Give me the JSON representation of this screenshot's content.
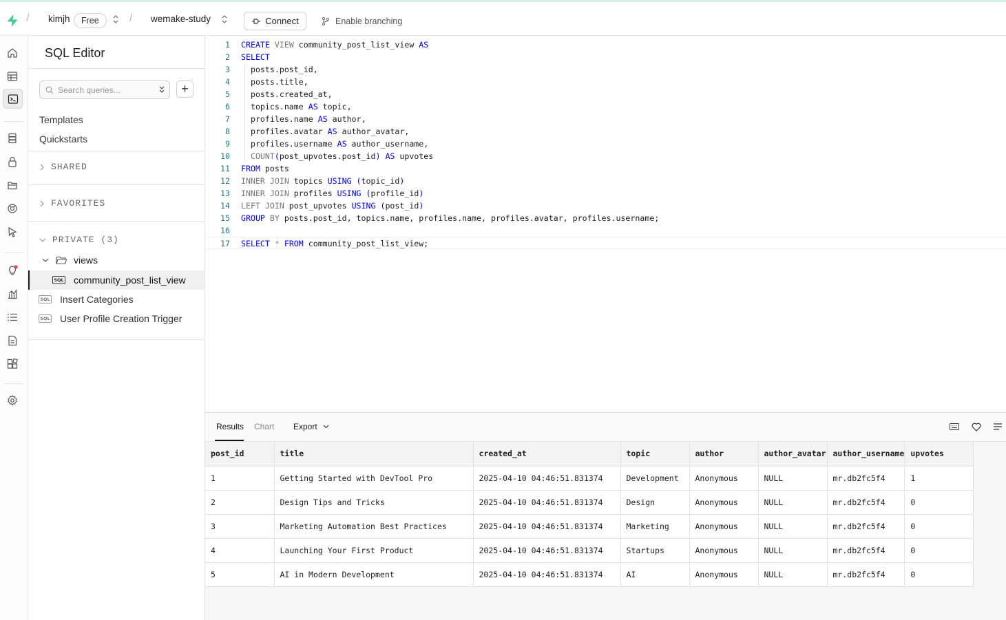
{
  "topbar": {
    "org": "kimjh",
    "plan": "Free",
    "project": "wemake-study",
    "connect_label": "Connect",
    "branching_label": "Enable branching"
  },
  "rail_icons": [
    "home-icon",
    "table-editor-icon",
    "sql-editor-icon",
    "database-icon",
    "auth-lock-icon",
    "storage-icon",
    "realtime-icon",
    "edge-functions-icon",
    "advisors-icon",
    "reports-icon",
    "logs-icon",
    "api-docs-icon",
    "integrations-icon",
    "settings-icon"
  ],
  "panel": {
    "title": "SQL Editor",
    "search_placeholder": "Search queries...",
    "add_label": "+",
    "links": [
      "Templates",
      "Quickstarts"
    ],
    "sections": {
      "shared": "SHARED",
      "favorites": "FAVORITES",
      "private": "PRIVATE (3)"
    },
    "folder": "views",
    "queries": [
      "community_post_list_view",
      "Insert Categories",
      "User Profile Creation Trigger"
    ],
    "sql_badge": "SQL"
  },
  "editor": {
    "line_numbers": [
      "1",
      "2",
      "3",
      "4",
      "5",
      "6",
      "7",
      "8",
      "9",
      "10",
      "11",
      "12",
      "13",
      "14",
      "15",
      "16",
      "17"
    ],
    "lines": [
      "CREATE VIEW community_post_list_view AS",
      "SELECT",
      "  posts.post_id,",
      "  posts.title,",
      "  posts.created_at,",
      "  topics.name AS topic,",
      "  profiles.name AS author,",
      "  profiles.avatar AS author_avatar,",
      "  profiles.username AS author_username,",
      "  COUNT(post_upvotes.post_id) AS upvotes",
      "FROM posts",
      "INNER JOIN topics USING (topic_id)",
      "INNER JOIN profiles USING (profile_id)",
      "LEFT JOIN post_upvotes USING (post_id)",
      "GROUP BY posts.post_id, topics.name, profiles.name, profiles.avatar, profiles.username;",
      "",
      "SELECT * FROM community_post_list_view;"
    ]
  },
  "results": {
    "tabs": [
      "Results",
      "Chart"
    ],
    "export_label": "Export",
    "columns": [
      "post_id",
      "title",
      "created_at",
      "topic",
      "author",
      "author_avatar",
      "author_username",
      "upvotes"
    ],
    "rows": [
      [
        "1",
        "Getting Started with DevTool Pro",
        "2025-04-10 04:46:51.831374",
        "Development",
        "Anonymous",
        "NULL",
        "mr.db2fc5f4",
        "1"
      ],
      [
        "2",
        "Design Tips and Tricks",
        "2025-04-10 04:46:51.831374",
        "Design",
        "Anonymous",
        "NULL",
        "mr.db2fc5f4",
        "0"
      ],
      [
        "3",
        "Marketing Automation Best Practices",
        "2025-04-10 04:46:51.831374",
        "Marketing",
        "Anonymous",
        "NULL",
        "mr.db2fc5f4",
        "0"
      ],
      [
        "4",
        "Launching Your First Product",
        "2025-04-10 04:46:51.831374",
        "Startups",
        "Anonymous",
        "NULL",
        "mr.db2fc5f4",
        "0"
      ],
      [
        "5",
        "AI in Modern Development",
        "2025-04-10 04:46:51.831374",
        "AI",
        "Anonymous",
        "NULL",
        "mr.db2fc5f4",
        "0"
      ]
    ]
  },
  "colors": {
    "brand": "#3ecf8e",
    "keyword": "#0000ff",
    "line_number": "#237893",
    "notification": "#e5484d"
  }
}
